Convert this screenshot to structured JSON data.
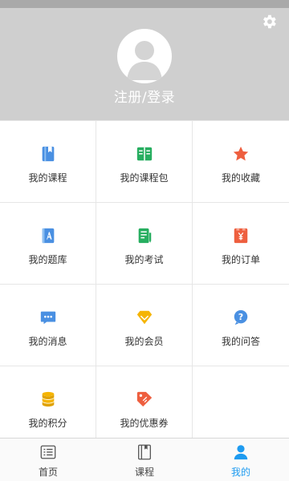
{
  "header": {
    "login_label": "注册/登录"
  },
  "menu": [
    {
      "label": "我的课程",
      "icon": "course-book-icon",
      "color": "#4a90e2"
    },
    {
      "label": "我的课程包",
      "icon": "open-book-icon",
      "color": "#27ae60"
    },
    {
      "label": "我的收藏",
      "icon": "star-icon",
      "color": "#ee5f3f"
    },
    {
      "label": "我的题库",
      "icon": "question-bank-icon",
      "color": "#4a90e2"
    },
    {
      "label": "我的考试",
      "icon": "exam-icon",
      "color": "#27ae60"
    },
    {
      "label": "我的订单",
      "icon": "order-icon",
      "color": "#ee5f3f"
    },
    {
      "label": "我的消息",
      "icon": "message-icon",
      "color": "#4a90e2"
    },
    {
      "label": "我的会员",
      "icon": "member-icon",
      "color": "#f5b400"
    },
    {
      "label": "我的问答",
      "icon": "question-answer-icon",
      "color": "#4a90e2"
    },
    {
      "label": "我的积分",
      "icon": "coins-icon",
      "color": "#f5b400"
    },
    {
      "label": "我的优惠券",
      "icon": "coupon-icon",
      "color": "#ee5f3f"
    }
  ],
  "tabbar": {
    "items": [
      {
        "label": "首页",
        "icon": "home-list-icon",
        "active": false
      },
      {
        "label": "课程",
        "icon": "course-book-icon",
        "active": false
      },
      {
        "label": "我的",
        "icon": "user-icon",
        "active": true
      }
    ]
  },
  "colors": {
    "accent": "#1e9bf0",
    "header_bg": "#cfcfcf"
  }
}
